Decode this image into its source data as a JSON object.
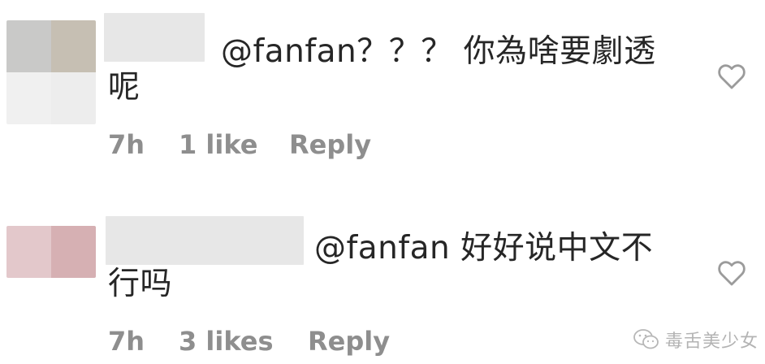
{
  "comments": [
    {
      "text_line1": "@fanfan？？？ 你為啥要劇透",
      "text_line2": "呢",
      "time": "7h",
      "likes": "1 like",
      "reply_label": "Reply"
    },
    {
      "text_line1": "@fanfan 好好说中文不",
      "text_line2": "行吗",
      "time": "7h",
      "likes": "3 likes",
      "reply_label": "Reply"
    }
  ],
  "watermark": {
    "text": "毒舌美少女",
    "icon": "wechat-icon"
  },
  "icons": {
    "like": "heart-outline-icon"
  },
  "colors": {
    "text": "#262626",
    "meta": "#8e8e8e",
    "redaction": "#e7e7e7"
  }
}
